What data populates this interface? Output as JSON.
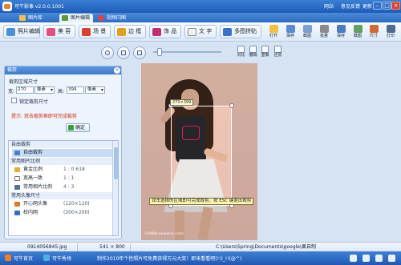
{
  "window": {
    "title": "可牛影像 v2.0.0.1001",
    "links": [
      "网站",
      "意见反馈",
      "更新"
    ],
    "controls": [
      "–",
      "□",
      "×"
    ]
  },
  "tabs": [
    {
      "label": "图片库",
      "active": false
    },
    {
      "label": "图片编辑",
      "active": true
    },
    {
      "label": "视频闪图",
      "active": false
    }
  ],
  "toolbar": {
    "tools": [
      "照片编辑",
      "美 容",
      "场 景",
      "边 框",
      "饰 品",
      "文 字",
      "多图拼贴"
    ],
    "actions": [
      "打开",
      "保存",
      "截图",
      "批量",
      "保存",
      "截图",
      "尺寸",
      "打印"
    ]
  },
  "image_toolbar": {
    "actions": [
      "对比",
      "撤销",
      "重做",
      "还原"
    ]
  },
  "crop_panel": {
    "title": "裁剪",
    "size_heading": "裁剪区域尺寸",
    "width_label": "宽:",
    "width_value": "270",
    "width_unit": "像素",
    "height_label": "高:",
    "height_value": "399",
    "height_unit": "像素",
    "lock_label": "锁定裁剪尺寸",
    "hint": "提示: 双击裁剪框即可完成裁剪",
    "ok_label": "确定",
    "groups": [
      {
        "label": "自由裁剪",
        "items": [
          {
            "label": "自由裁剪",
            "value": "",
            "selected": true
          }
        ]
      },
      {
        "label": "常用图片比例",
        "items": [
          {
            "label": "黄金比例",
            "value": "1 : 0.618",
            "selected": false
          },
          {
            "label": "宽高一致",
            "value": "1 : 1",
            "selected": false
          },
          {
            "label": "常用相片比例",
            "value": "4 : 3",
            "selected": false
          }
        ]
      },
      {
        "label": "常用头像尺寸",
        "items": [
          {
            "label": "开心网头像",
            "value": "(120×120)",
            "selected": false
          },
          {
            "label": "校内网",
            "value": "(200×200)",
            "selected": false
          }
        ]
      }
    ]
  },
  "canvas": {
    "crop_size": "270×399",
    "crop_hint": "双击选择的区域即可完成裁剪，按 ESC 键退出裁剪",
    "watermark": "可牛影像 www.keniu.com"
  },
  "status": {
    "filename": "0914056845.jpg",
    "dimensions": "541 × 800",
    "path": "C:\\Users\\Spring\\Documents\\google\\果自制"
  },
  "bottom_bar": {
    "links": [
      "可牛首页",
      "可牛秀场"
    ],
    "marquee": "制作2010年个性照片可免费获得万元大奖！即来看看吧(!!)_!!(@^)"
  },
  "colors": {
    "titlebar": "#2a6cc6",
    "accent": "#3e78cc",
    "hint_text": "#d03010",
    "photo_bg": "#efc5b4"
  }
}
